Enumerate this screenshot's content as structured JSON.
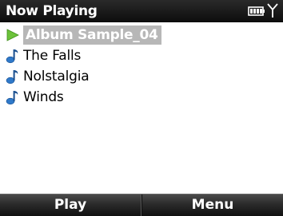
{
  "title": "Now Playing",
  "status": {
    "battery_icon": "battery-icon",
    "signal_icon": "signal-icon"
  },
  "playlist": [
    {
      "label": "Album Sample_04",
      "icon": "play-arrow-icon",
      "selected": true
    },
    {
      "label": "The Falls",
      "icon": "music-note-icon",
      "selected": false
    },
    {
      "label": "Nolstalgia",
      "icon": "music-note-icon",
      "selected": false
    },
    {
      "label": "Winds",
      "icon": "music-note-icon",
      "selected": false
    }
  ],
  "softkeys": {
    "left": "Play",
    "right": "Menu"
  },
  "colors": {
    "play_arrow": "#6cc23a",
    "note": "#2f79c9",
    "selection": "#b7b7b7"
  }
}
